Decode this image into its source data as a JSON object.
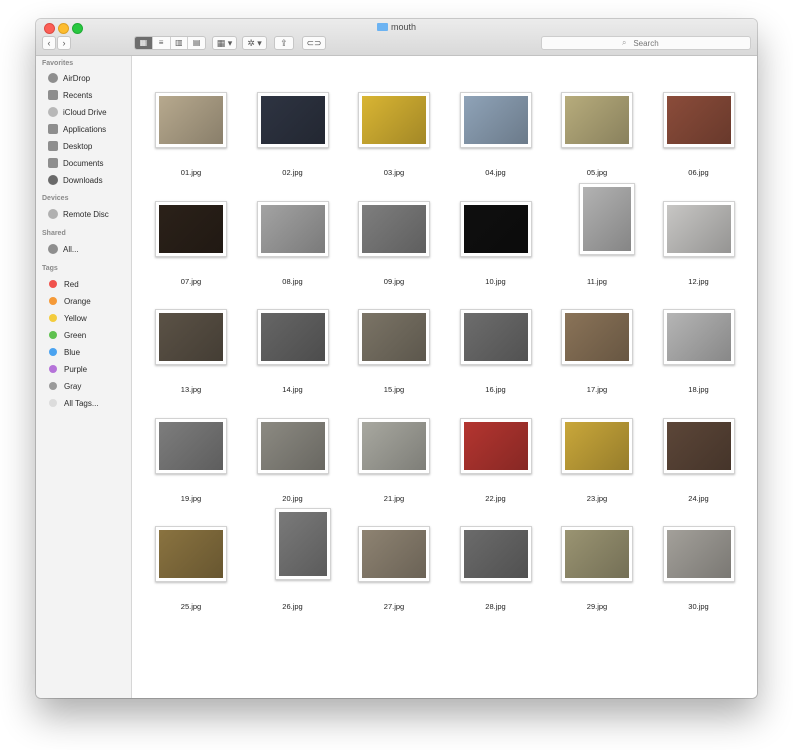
{
  "window": {
    "title": "mouth",
    "search_placeholder": "Search"
  },
  "toolbar": {
    "back_label": "‹",
    "forward_label": "›",
    "view_icons": [
      "▦",
      "≡",
      "▥",
      "▤"
    ],
    "group_label": "▦ ▾",
    "action_label": "✲ ▾",
    "share_label": "⇪",
    "tag_label": "⊂⊃"
  },
  "sidebar": {
    "favorites_title": "Favorites",
    "favorites": [
      "AirDrop",
      "Recents",
      "iCloud Drive",
      "Applications",
      "Desktop",
      "Documents",
      "Downloads"
    ],
    "devices_title": "Devices",
    "devices": [
      "Remote Disc"
    ],
    "shared_title": "Shared",
    "shared": [
      "All..."
    ],
    "tags_title": "Tags",
    "tags": [
      {
        "label": "Red",
        "color": "#f0524c"
      },
      {
        "label": "Orange",
        "color": "#f59a38"
      },
      {
        "label": "Yellow",
        "color": "#f3cc3d"
      },
      {
        "label": "Green",
        "color": "#5fc14f"
      },
      {
        "label": "Blue",
        "color": "#4aa3f0"
      },
      {
        "label": "Purple",
        "color": "#b573d9"
      },
      {
        "label": "Gray",
        "color": "#9a9a9a"
      },
      {
        "label": "All Tags...",
        "color": "#dcdcdc"
      }
    ]
  },
  "files": [
    {
      "name": "01.jpg",
      "color": "#b7a98e",
      "orient": "landscape"
    },
    {
      "name": "02.jpg",
      "color": "#2e3442",
      "orient": "landscape"
    },
    {
      "name": "03.jpg",
      "color": "#d9b533",
      "orient": "landscape"
    },
    {
      "name": "04.jpg",
      "color": "#8fa3b8",
      "orient": "landscape"
    },
    {
      "name": "05.jpg",
      "color": "#b7ac7c",
      "orient": "landscape"
    },
    {
      "name": "06.jpg",
      "color": "#8b4c3a",
      "orient": "landscape"
    },
    {
      "name": "07.jpg",
      "color": "#2b2119",
      "orient": "landscape"
    },
    {
      "name": "08.jpg",
      "color": "#a3a3a3",
      "orient": "landscape"
    },
    {
      "name": "09.jpg",
      "color": "#7e7e7e",
      "orient": "landscape"
    },
    {
      "name": "10.jpg",
      "color": "#0f0f0f",
      "orient": "landscape"
    },
    {
      "name": "11.jpg",
      "color": "#b2b2b2",
      "orient": "portrait"
    },
    {
      "name": "12.jpg",
      "color": "#c7c6c4",
      "orient": "landscape"
    },
    {
      "name": "13.jpg",
      "color": "#5b5246",
      "orient": "landscape"
    },
    {
      "name": "14.jpg",
      "color": "#666666",
      "orient": "landscape"
    },
    {
      "name": "15.jpg",
      "color": "#7b7466",
      "orient": "landscape"
    },
    {
      "name": "16.jpg",
      "color": "#6d6d6d",
      "orient": "landscape"
    },
    {
      "name": "17.jpg",
      "color": "#8a7358",
      "orient": "landscape"
    },
    {
      "name": "18.jpg",
      "color": "#b5b5b5",
      "orient": "landscape"
    },
    {
      "name": "19.jpg",
      "color": "#7d7d7d",
      "orient": "landscape"
    },
    {
      "name": "20.jpg",
      "color": "#8c8a82",
      "orient": "landscape"
    },
    {
      "name": "21.jpg",
      "color": "#a8a8a0",
      "orient": "landscape"
    },
    {
      "name": "22.jpg",
      "color": "#b43530",
      "orient": "landscape"
    },
    {
      "name": "23.jpg",
      "color": "#c9a73a",
      "orient": "landscape"
    },
    {
      "name": "24.jpg",
      "color": "#5c4638",
      "orient": "landscape"
    },
    {
      "name": "25.jpg",
      "color": "#8a7340",
      "orient": "landscape"
    },
    {
      "name": "26.jpg",
      "color": "#7a7a7a",
      "orient": "portrait"
    },
    {
      "name": "27.jpg",
      "color": "#8e8372",
      "orient": "landscape"
    },
    {
      "name": "28.jpg",
      "color": "#6b6b6b",
      "orient": "landscape"
    },
    {
      "name": "29.jpg",
      "color": "#9a9472",
      "orient": "landscape"
    },
    {
      "name": "30.jpg",
      "color": "#a3a09a",
      "orient": "landscape"
    }
  ]
}
